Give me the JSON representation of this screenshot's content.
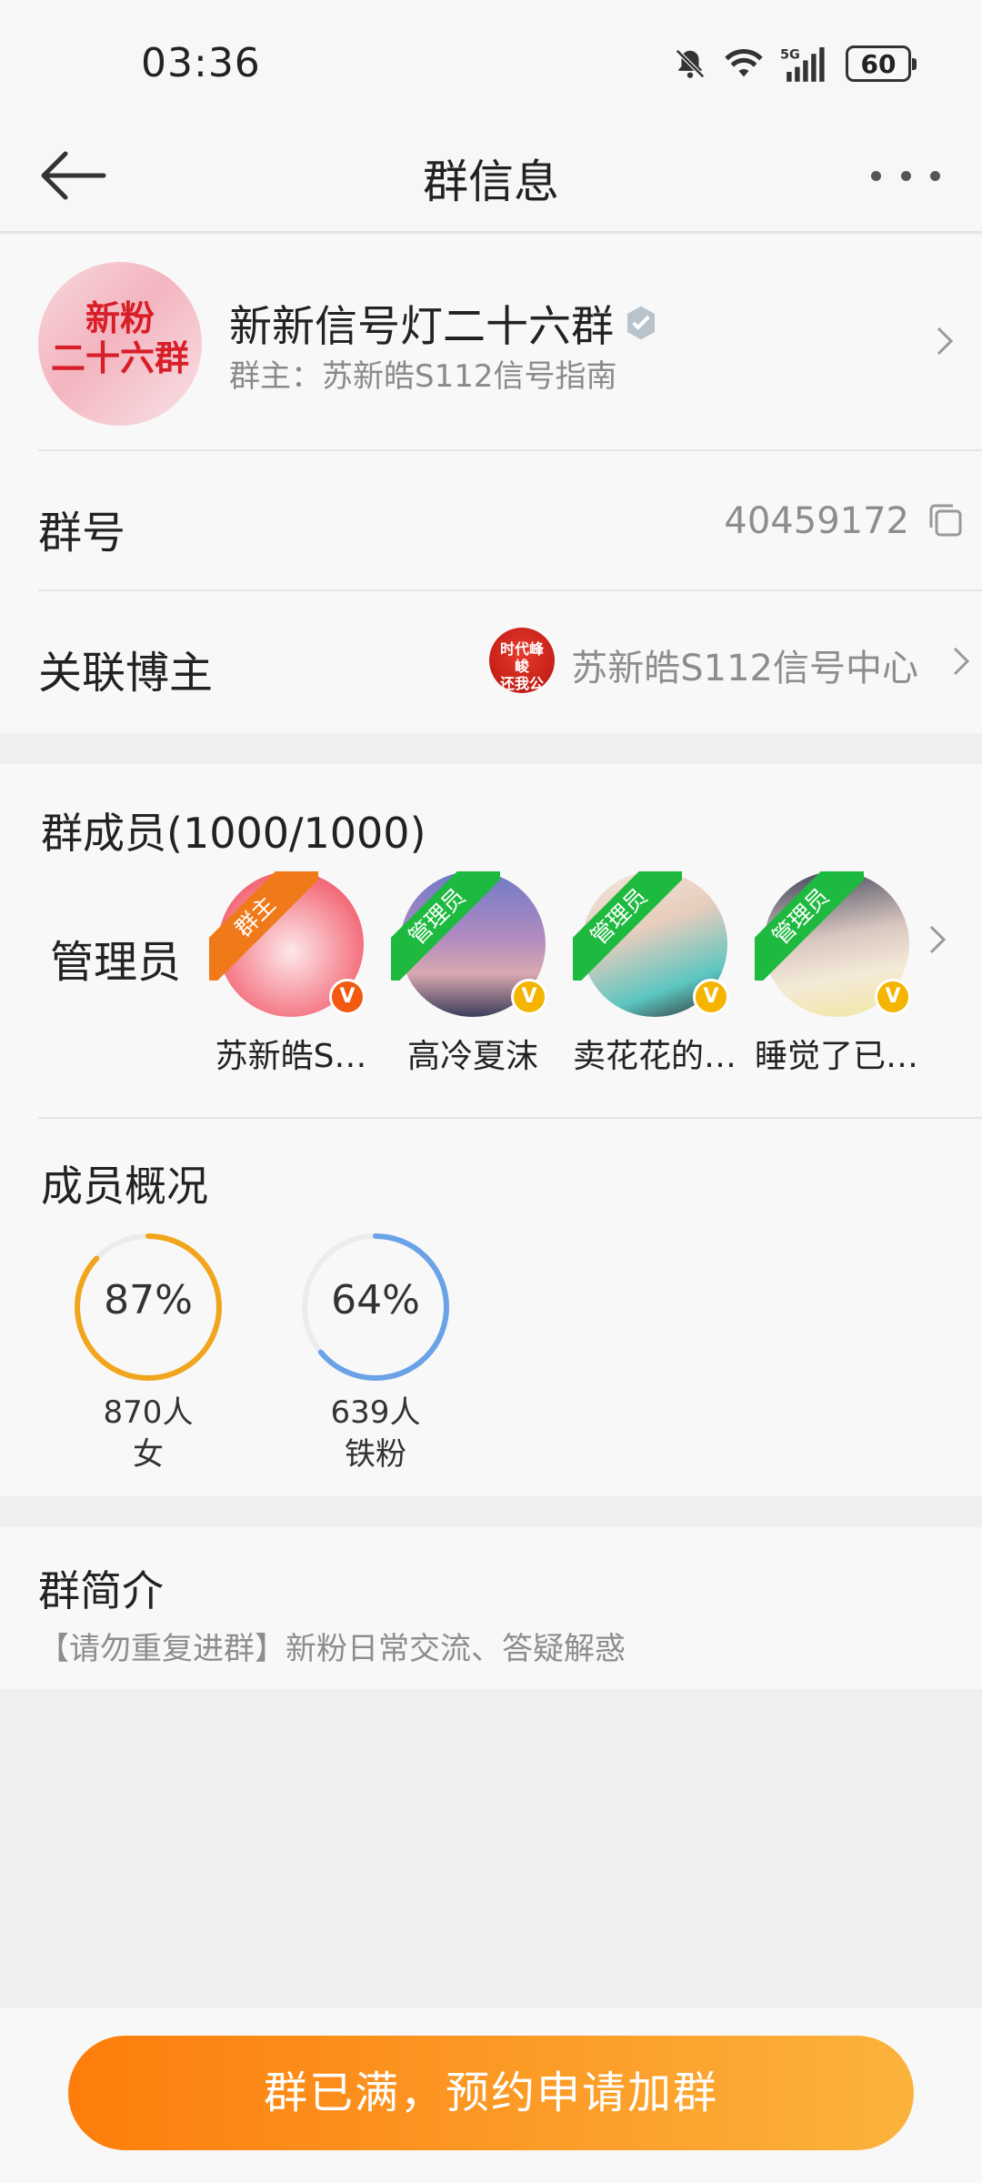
{
  "status_bar": {
    "time": "03:36",
    "battery": "60"
  },
  "nav": {
    "title": "群信息"
  },
  "group": {
    "avatar_text_line1": "新粉",
    "avatar_text_line2": "二十六群",
    "name": "新新信号灯二十六群",
    "owner_label": "群主：苏新皓S112信号指南"
  },
  "group_number": {
    "label": "群号",
    "value": "40459172"
  },
  "linked_blogger": {
    "label": "关联博主",
    "name": "苏新皓S112信号中心",
    "avatar_text": "时代峰峻\n还我公主"
  },
  "members": {
    "title": "群成员(1000/1000)",
    "admin_label": "管理员",
    "admins": [
      {
        "name": "苏新皓S…",
        "role": "群主"
      },
      {
        "name": "高冷夏沫",
        "role": "管理员"
      },
      {
        "name": "卖花花的…",
        "role": "管理员"
      },
      {
        "name": "睡觉了已…",
        "role": "管理员"
      }
    ]
  },
  "overview": {
    "title": "成员概况",
    "stats": [
      {
        "percent": "87%",
        "percent_value": 0.87,
        "count": "870人",
        "label": "女",
        "color": "#f1a51c"
      },
      {
        "percent": "64%",
        "percent_value": 0.64,
        "count": "639人",
        "label": "铁粉",
        "color": "#6aa2e8"
      }
    ]
  },
  "intro": {
    "title": "群简介",
    "text": "【请勿重复进群】新粉日常交流、答疑解惑"
  },
  "join_button": {
    "label": "群已满，预约申请加群"
  }
}
